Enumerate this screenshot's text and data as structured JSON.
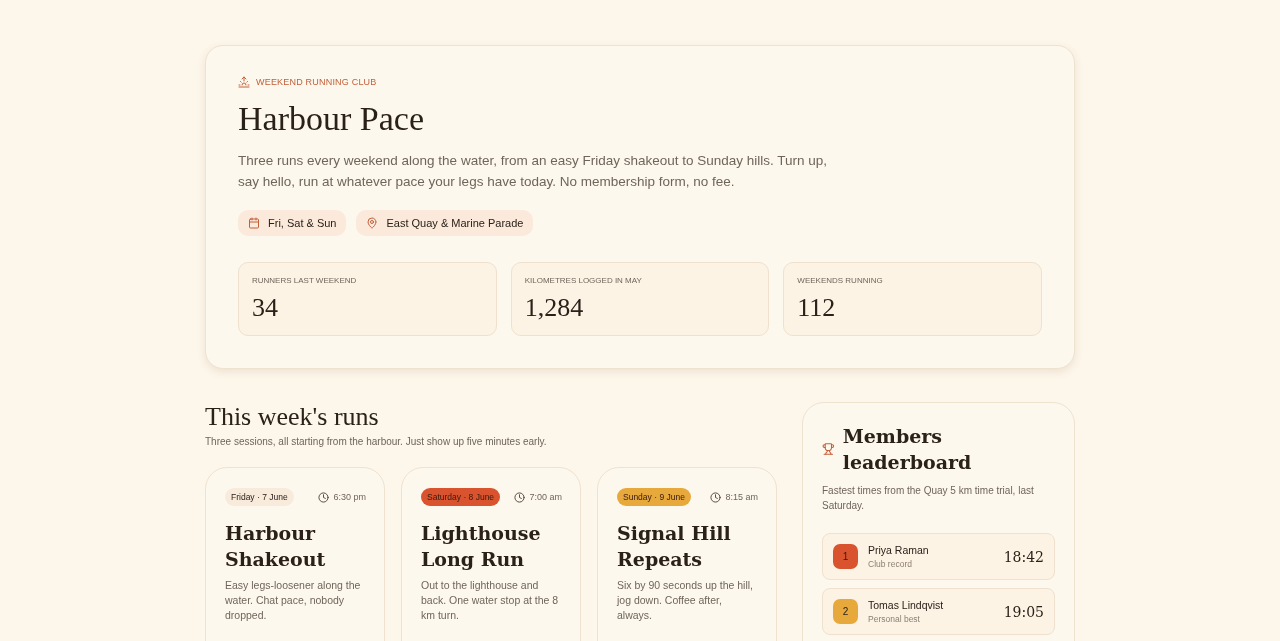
{
  "hero": {
    "eyebrow": "WEEKEND RUNNING CLUB",
    "title": "Harbour Pace",
    "description": "Three runs every weekend along the water, from an easy Friday shakeout to Sunday hills. Turn up, say hello, run at whatever pace your legs have today. No membership form, no fee.",
    "chips": [
      {
        "kind": "calendar",
        "label": "Fri, Sat & Sun"
      },
      {
        "kind": "location",
        "label": "East Quay & Marine Parade"
      }
    ],
    "stats": [
      {
        "label": "RUNNERS LAST WEEKEND",
        "value": "34"
      },
      {
        "label": "KILOMETRES LOGGED IN MAY",
        "value": "1,284"
      },
      {
        "label": "WEEKENDS RUNNING",
        "value": "112"
      }
    ]
  },
  "runs_section": {
    "title": "This week's runs",
    "subtitle": "Three sessions, all starting from the harbour. Just show up five minutes early.",
    "runs": [
      {
        "day": "Friday · 7 June",
        "color": "#f8ebdc",
        "time": "6:30 pm",
        "title": "Harbour Shakeout",
        "description": "Easy legs-loosener along the water. Chat pace, nobody dropped."
      },
      {
        "day": "Saturday · 8 June",
        "color": "#d9532f",
        "time": "7:00 am",
        "title": "Lighthouse Long Run",
        "description": "Out to the lighthouse and back. One water stop at the 8 km turn."
      },
      {
        "day": "Sunday · 9 June",
        "color": "#e8a93c",
        "time": "8:15 am",
        "title": "Signal Hill Repeats",
        "description": "Six by 90 seconds up the hill, jog down. Coffee after, always."
      }
    ]
  },
  "leaderboard": {
    "title": "Members leaderboard",
    "subtitle": "Fastest times from the Quay 5 km time trial, last Saturday.",
    "entries": [
      {
        "rank": "1",
        "color": "#d9532f",
        "name": "Priya Raman",
        "note": "Club record",
        "time": "18:42"
      },
      {
        "rank": "2",
        "color": "#e8a93c",
        "name": "Tomas Lindqvist",
        "note": "Personal best",
        "time": "19:05"
      }
    ]
  }
}
